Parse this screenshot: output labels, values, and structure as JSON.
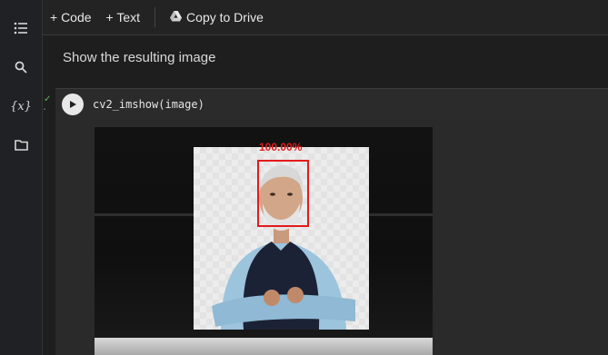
{
  "toolbar": {
    "code_label": "+ Code",
    "text_label": "+ Text",
    "drive_label": "Copy to Drive"
  },
  "sidebar": {
    "items": [
      {
        "icon": "table-of-contents-icon"
      },
      {
        "icon": "search-icon"
      },
      {
        "icon": "variables-icon",
        "label": "{x}"
      },
      {
        "icon": "files-folder-icon"
      }
    ]
  },
  "text_cell": {
    "text": "Show the resulting image"
  },
  "code_cell": {
    "code": "cv2_imshow(image)",
    "exec_check": "✓"
  },
  "output": {
    "detection_label": "100.00%"
  },
  "colors": {
    "accent_box": "#e31b1b",
    "check": "#5fb760",
    "background": "#1f1f1f"
  }
}
